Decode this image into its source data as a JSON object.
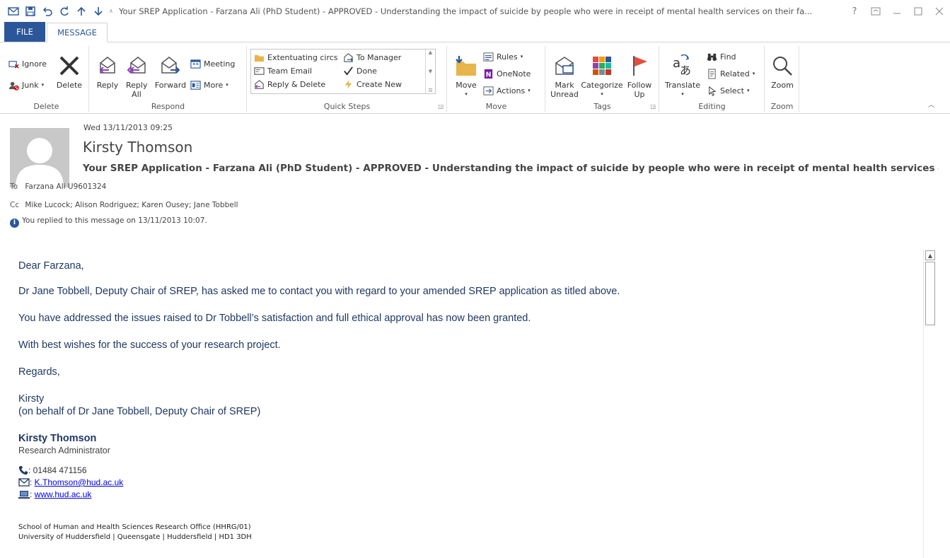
{
  "window": {
    "title": "Your SREP Application - Farzana Ali (PhD Student) - APPROVED - Understanding the impact of suicide by people who were in receipt of mental health services on their fa...",
    "help": "?"
  },
  "tabs": {
    "file": "FILE",
    "message": "MESSAGE"
  },
  "ribbon": {
    "delete_group": {
      "label": "Delete",
      "ignore": "Ignore",
      "junk": "Junk",
      "delete": "Delete"
    },
    "respond_group": {
      "label": "Respond",
      "reply": "Reply",
      "reply_all": "Reply All",
      "forward": "Forward",
      "meeting": "Meeting",
      "more": "More"
    },
    "quick_steps": {
      "label": "Quick Steps",
      "items": [
        "Extentuating circs",
        "To Manager",
        "Team Email",
        "Done",
        "Reply & Delete",
        "Create New"
      ]
    },
    "move_group": {
      "label": "Move",
      "move": "Move",
      "rules": "Rules",
      "onenote": "OneNote",
      "actions": "Actions"
    },
    "tags_group": {
      "label": "Tags",
      "mark_unread": "Mark Unread",
      "categorize": "Categorize",
      "follow_up": "Follow Up"
    },
    "editing_group": {
      "label": "Editing",
      "translate": "Translate",
      "find": "Find",
      "related": "Related",
      "select": "Select"
    },
    "zoom_group": {
      "label": "Zoom",
      "zoom": "Zoom"
    }
  },
  "header": {
    "date": "Wed 13/11/2013 09:25",
    "sender": "Kirsty Thomson",
    "subject": "Your SREP Application - Farzana Ali (PhD Student) - APPROVED - Understanding the impact of suicide by people who were in receipt of mental health services on their fa",
    "to_label": "To",
    "to": "Farzana Ali U9601324",
    "cc_label": "Cc",
    "cc": "Mike Lucock; Alison Rodriguez; Karen Ousey; Jane Tobbell",
    "info": "You replied to this message on 13/11/2013 10:07."
  },
  "body": {
    "greeting": "Dear Farzana,",
    "p1": "Dr Jane Tobbell, Deputy Chair of SREP, has asked me to contact you with regard to your amended SREP application as titled above.",
    "p2": "You have addressed the issues raised to Dr Tobbell’s satisfaction and full ethical approval has now been granted.",
    "p3": "With best wishes for the success of your research project.",
    "regards": "Regards,",
    "signoff_name": "Kirsty",
    "signoff_behalf": "(on behalf of Dr Jane Tobbell, Deputy Chair of SREP)"
  },
  "signature": {
    "name": "Kirsty Thomson",
    "role": "Research Administrator",
    "phone": ": 01484 471156",
    "email": "K.Thomson@hud.ac.uk",
    "web": "www.hud.ac.uk",
    "office": "School of Human and Health Sciences Research Office (HHRG/01)",
    "address": "University of Huddersfield | Queensgate | Huddersfield | HD1 3DH"
  },
  "colors": {
    "accent": "#2b579a",
    "body_text": "#1f3864",
    "link": "#0000ee"
  }
}
